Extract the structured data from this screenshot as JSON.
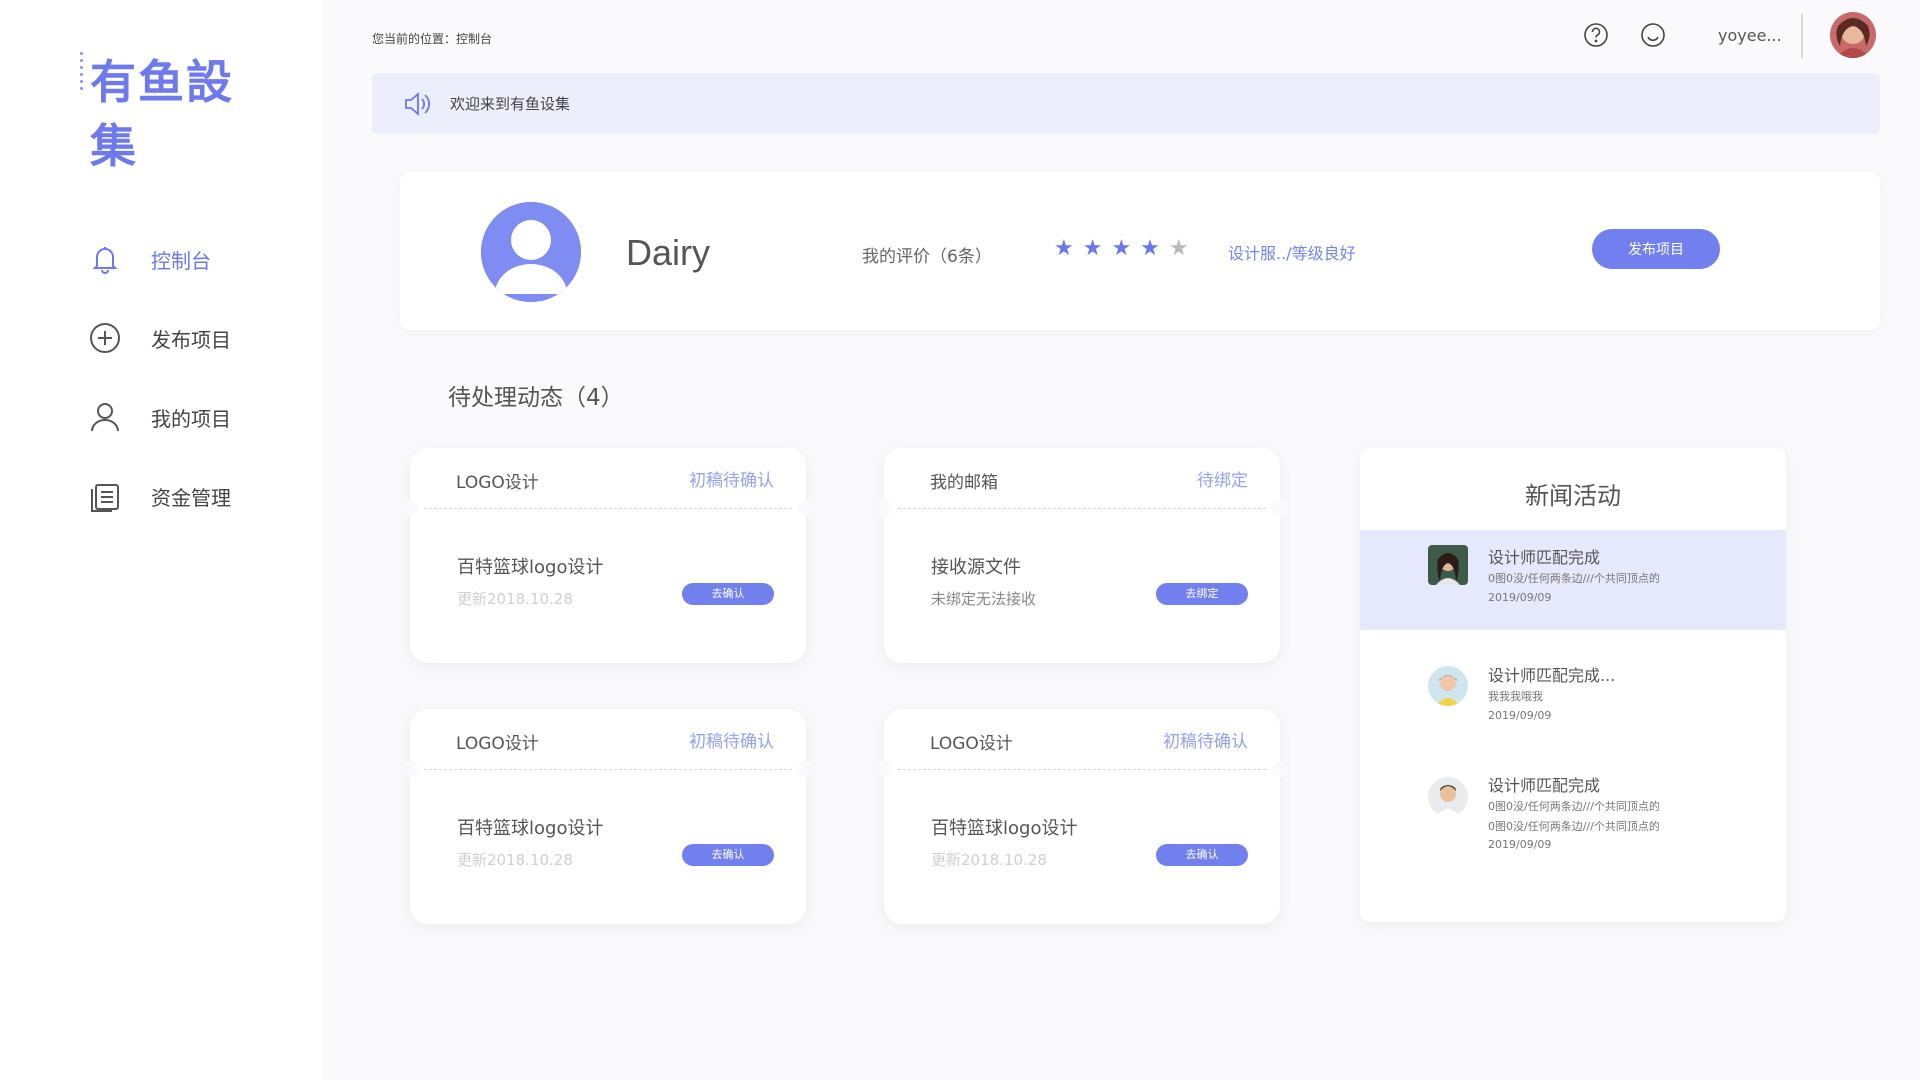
{
  "app": {
    "logo_text": "有鱼設集"
  },
  "sidebar": {
    "items": [
      {
        "label": "控制台",
        "icon": "bell-icon",
        "active": true
      },
      {
        "label": "发布项目",
        "icon": "plus-circle-icon",
        "active": false
      },
      {
        "label": "我的项目",
        "icon": "user-icon",
        "active": false
      },
      {
        "label": "资金管理",
        "icon": "document-list-icon",
        "active": false
      }
    ]
  },
  "header": {
    "breadcrumb": "您当前的位置：控制台",
    "help_icon": "help-circle-icon",
    "feedback_icon": "smile-icon",
    "username": "yoyee..."
  },
  "notice": {
    "icon": "speaker-icon",
    "text": "欢迎来到有鱼设集"
  },
  "profile": {
    "name": "Dairy",
    "evaluation_label": "我的评价（6条）",
    "rating": 4,
    "rating_max": 5,
    "stars_on": "★★★★",
    "stars_off": "★",
    "level_text": "设计服../等级良好",
    "publish_button": "发布项目"
  },
  "pending": {
    "title": "待处理动态（4）",
    "cards": [
      {
        "title": "LOGO设计",
        "status": "初稿待确认",
        "body_title": "百特篮球logo设计",
        "body_sub": "更新2018.10.28",
        "action": "去确认"
      },
      {
        "title": "我的邮箱",
        "status": "待绑定",
        "body_title": "接收源文件",
        "body_sub": "未绑定无法接收",
        "action": "去绑定"
      },
      {
        "title": "LOGO设计",
        "status": "初稿待确认",
        "body_title": "百特篮球logo设计",
        "body_sub": "更新2018.10.28",
        "action": "去确认"
      },
      {
        "title": "LOGO设计",
        "status": "初稿待确认",
        "body_title": "百特篮球logo设计",
        "body_sub": "更新2018.10.28",
        "action": "去确认"
      }
    ]
  },
  "news": {
    "title": "新闻活动",
    "items": [
      {
        "title": "设计师匹配完成",
        "lines": [
          "0图0没/任何两条边///个共同顶点的"
        ],
        "date": "2019/09/09",
        "highlighted": true
      },
      {
        "title": "设计师匹配完成...",
        "lines": [
          "我我我哦我"
        ],
        "date": "2019/09/09",
        "highlighted": false
      },
      {
        "title": "设计师匹配完成",
        "lines": [
          "0图0没/任何两条边///个共同顶点的",
          "0图0没/任何两条边///个共同顶点的"
        ],
        "date": "2019/09/09",
        "highlighted": false
      }
    ]
  },
  "colors": {
    "accent": "#6b77ee",
    "notice_bg": "#eceefc",
    "highlight_bg": "#e6e8fc",
    "status_text": "#96a0f2"
  }
}
